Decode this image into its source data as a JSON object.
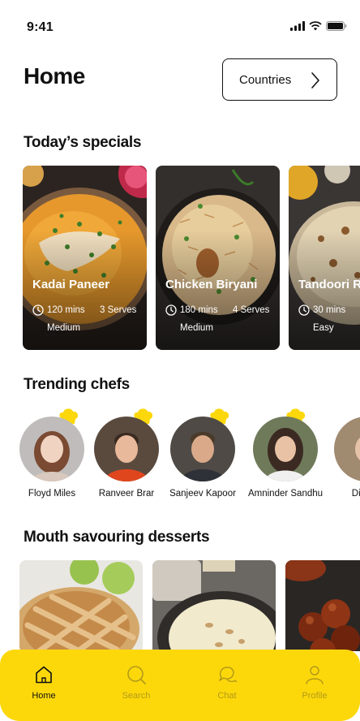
{
  "status_bar": {
    "time": "9:41"
  },
  "header": {
    "title": "Home",
    "countries_label": "Countries"
  },
  "specials": {
    "title": "Today’s specials",
    "items": [
      {
        "name": "Kadai Paneer",
        "time": "120 mins",
        "serves": "3 Serves",
        "level": "Medium"
      },
      {
        "name": "Chicken Biryani",
        "time": "180 mins",
        "serves": "4 Serves",
        "level": "Medium"
      },
      {
        "name": "Tandoori Roti",
        "time": "30 mins",
        "serves": "",
        "level": "Easy"
      }
    ]
  },
  "chefs": {
    "title": "Trending chefs",
    "items": [
      {
        "name": "Floyd Miles"
      },
      {
        "name": "Ranveer Brar"
      },
      {
        "name": "Sanjeev Kapoor"
      },
      {
        "name": "Amninder Sandhu"
      },
      {
        "name": "Dianne"
      }
    ]
  },
  "desserts": {
    "title": "Mouth savouring desserts"
  },
  "tab_bar": {
    "items": [
      {
        "label": "Home",
        "icon": "home-icon",
        "active": true
      },
      {
        "label": "Search",
        "icon": "search-icon",
        "active": false
      },
      {
        "label": "Chat",
        "icon": "chat-icon",
        "active": false
      },
      {
        "label": "Profile",
        "icon": "profile-icon",
        "active": false
      }
    ]
  },
  "colors": {
    "accent": "#fcd80b",
    "text": "#111111",
    "inactive_tab": "#b39a18"
  }
}
